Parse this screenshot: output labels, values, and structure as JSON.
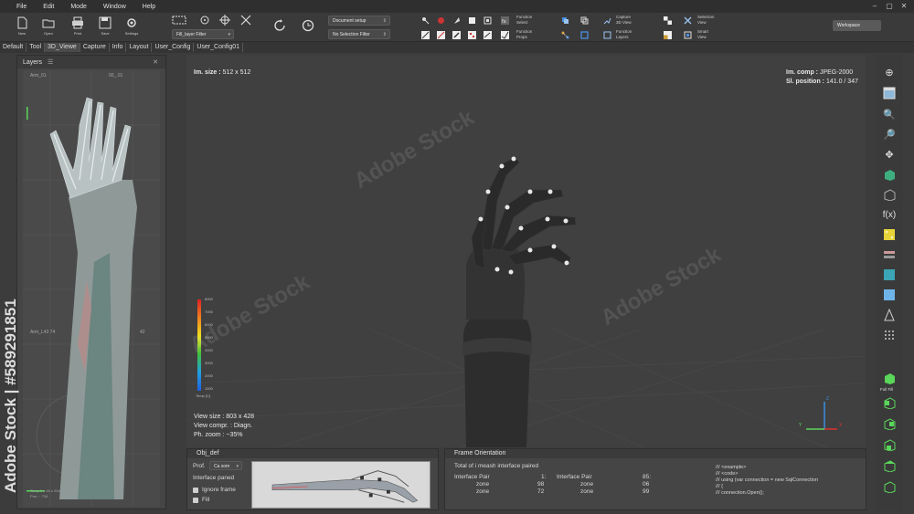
{
  "menu": [
    "File",
    "Edit",
    "Mode",
    "Window",
    "Help"
  ],
  "toolbar": {
    "buttons": [
      {
        "name": "new",
        "label": "New"
      },
      {
        "name": "open",
        "label": "Open"
      },
      {
        "name": "print",
        "label": "Print"
      },
      {
        "name": "save",
        "label": "Save"
      },
      {
        "name": "settings",
        "label": "Settings"
      }
    ],
    "fill_filter": "Fill_layer Filter",
    "document_setup": "Document setup",
    "selection_filter": "No Selection Filter",
    "function_select": "Function\nSelect",
    "function_props": "Function\nProps",
    "capture_3d": "Capture\n3D View",
    "function_layers": "Function\nLayers",
    "selection_view": "Selection\nView",
    "smart_view": "Smart\nView",
    "workspace": "Workspace"
  },
  "tabs": [
    "Default",
    "Tool",
    "3D_Viewe",
    "Capture",
    "Info",
    "Layout",
    "User_Config",
    "User_Config01"
  ],
  "layers": {
    "title": "Layers",
    "top_label": "Arm_01",
    "top_num": "00_.01",
    "mid_label": "Arm_L43  74",
    "mid_num": "42",
    "bottom_label": "Temp  1 x 45 x 294",
    "bottom_label2": "Pos: ~ 734"
  },
  "viewport": {
    "im_size_label": "Im. size :",
    "im_size": "512 x 512",
    "im_comp_label": "Im. comp :",
    "im_comp": "JPEG-2000",
    "sl_pos_label": "Sl. position :",
    "sl_pos": "141.0 / 347",
    "view_size": "View size : 803 x 428",
    "view_compr": "View compr. : Diagn.",
    "ph_zoom": "Ph. zoom : ~35%",
    "legend_ticks": [
      "8000",
      "7000",
      "6000",
      "5000",
      "4000",
      "3000",
      "2000",
      "1000"
    ],
    "legend_label": "Temp [C]",
    "axis_y": "Y",
    "axis_z": "Z",
    "axis_x": "X"
  },
  "right_tools": {
    "fx": "f(x)",
    "full_fill": "Full Fill"
  },
  "obj_panel": {
    "title": "Obj_def",
    "prof_label": "Prof.",
    "prof_value": "Ca som",
    "interface": "Interface paned",
    "ignore_frame": "Ignore frame",
    "fill": "Fill"
  },
  "frame_panel": {
    "title": "Frame Orientation",
    "total": "Total of i meash interface paired",
    "rows": [
      {
        "a": "Interface Pair",
        "b": "1:",
        "c": "Interface Pair",
        "d": "85:"
      },
      {
        "a": "zone",
        "b": "98",
        "c": "zone",
        "d": "06"
      },
      {
        "a": "zone",
        "b": "72",
        "c": "zone",
        "d": "99"
      }
    ],
    "code": [
      "/// <example>",
      "/// <code>",
      "/// using (var connection = new SqlConnection",
      "/// {",
      "///     connection.Open();"
    ]
  },
  "watermark": {
    "vertical": "Adobe Stock | #589291851",
    "tile": "Adobe Stock"
  },
  "colors": {
    "accent_green": "#5ad65a",
    "accent_blue": "#3a8fe0",
    "accent_red": "#e03030"
  }
}
